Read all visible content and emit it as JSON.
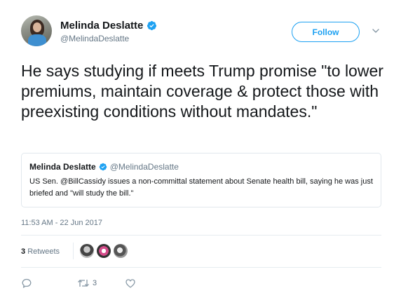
{
  "author": {
    "display_name": "Melinda Deslatte",
    "handle": "@MelindaDeslatte",
    "avatar_icon": "profile-photo",
    "verified_icon": "verified-badge-icon"
  },
  "follow": {
    "label": "Follow"
  },
  "tweet": {
    "text": "He says studying if meets Trump promise \"to lower premiums, maintain coverage & protect those with preexisting conditions without mandates.\"",
    "timestamp": "11:53 AM - 22 Jun 2017"
  },
  "quoted_tweet": {
    "display_name": "Melinda Deslatte",
    "handle": "@MelindaDeslatte",
    "text": "US Sen. @BillCassidy issues a non-committal statement about Senate health bill, saying he was just briefed and \"will study the bill.\""
  },
  "stats": {
    "retweet_count": "3",
    "retweet_label": "Retweets"
  },
  "actions": {
    "retweet_count": "3"
  },
  "colors": {
    "accent": "#1da1f2",
    "muted_text": "#657786",
    "border": "#e1e8ed"
  }
}
